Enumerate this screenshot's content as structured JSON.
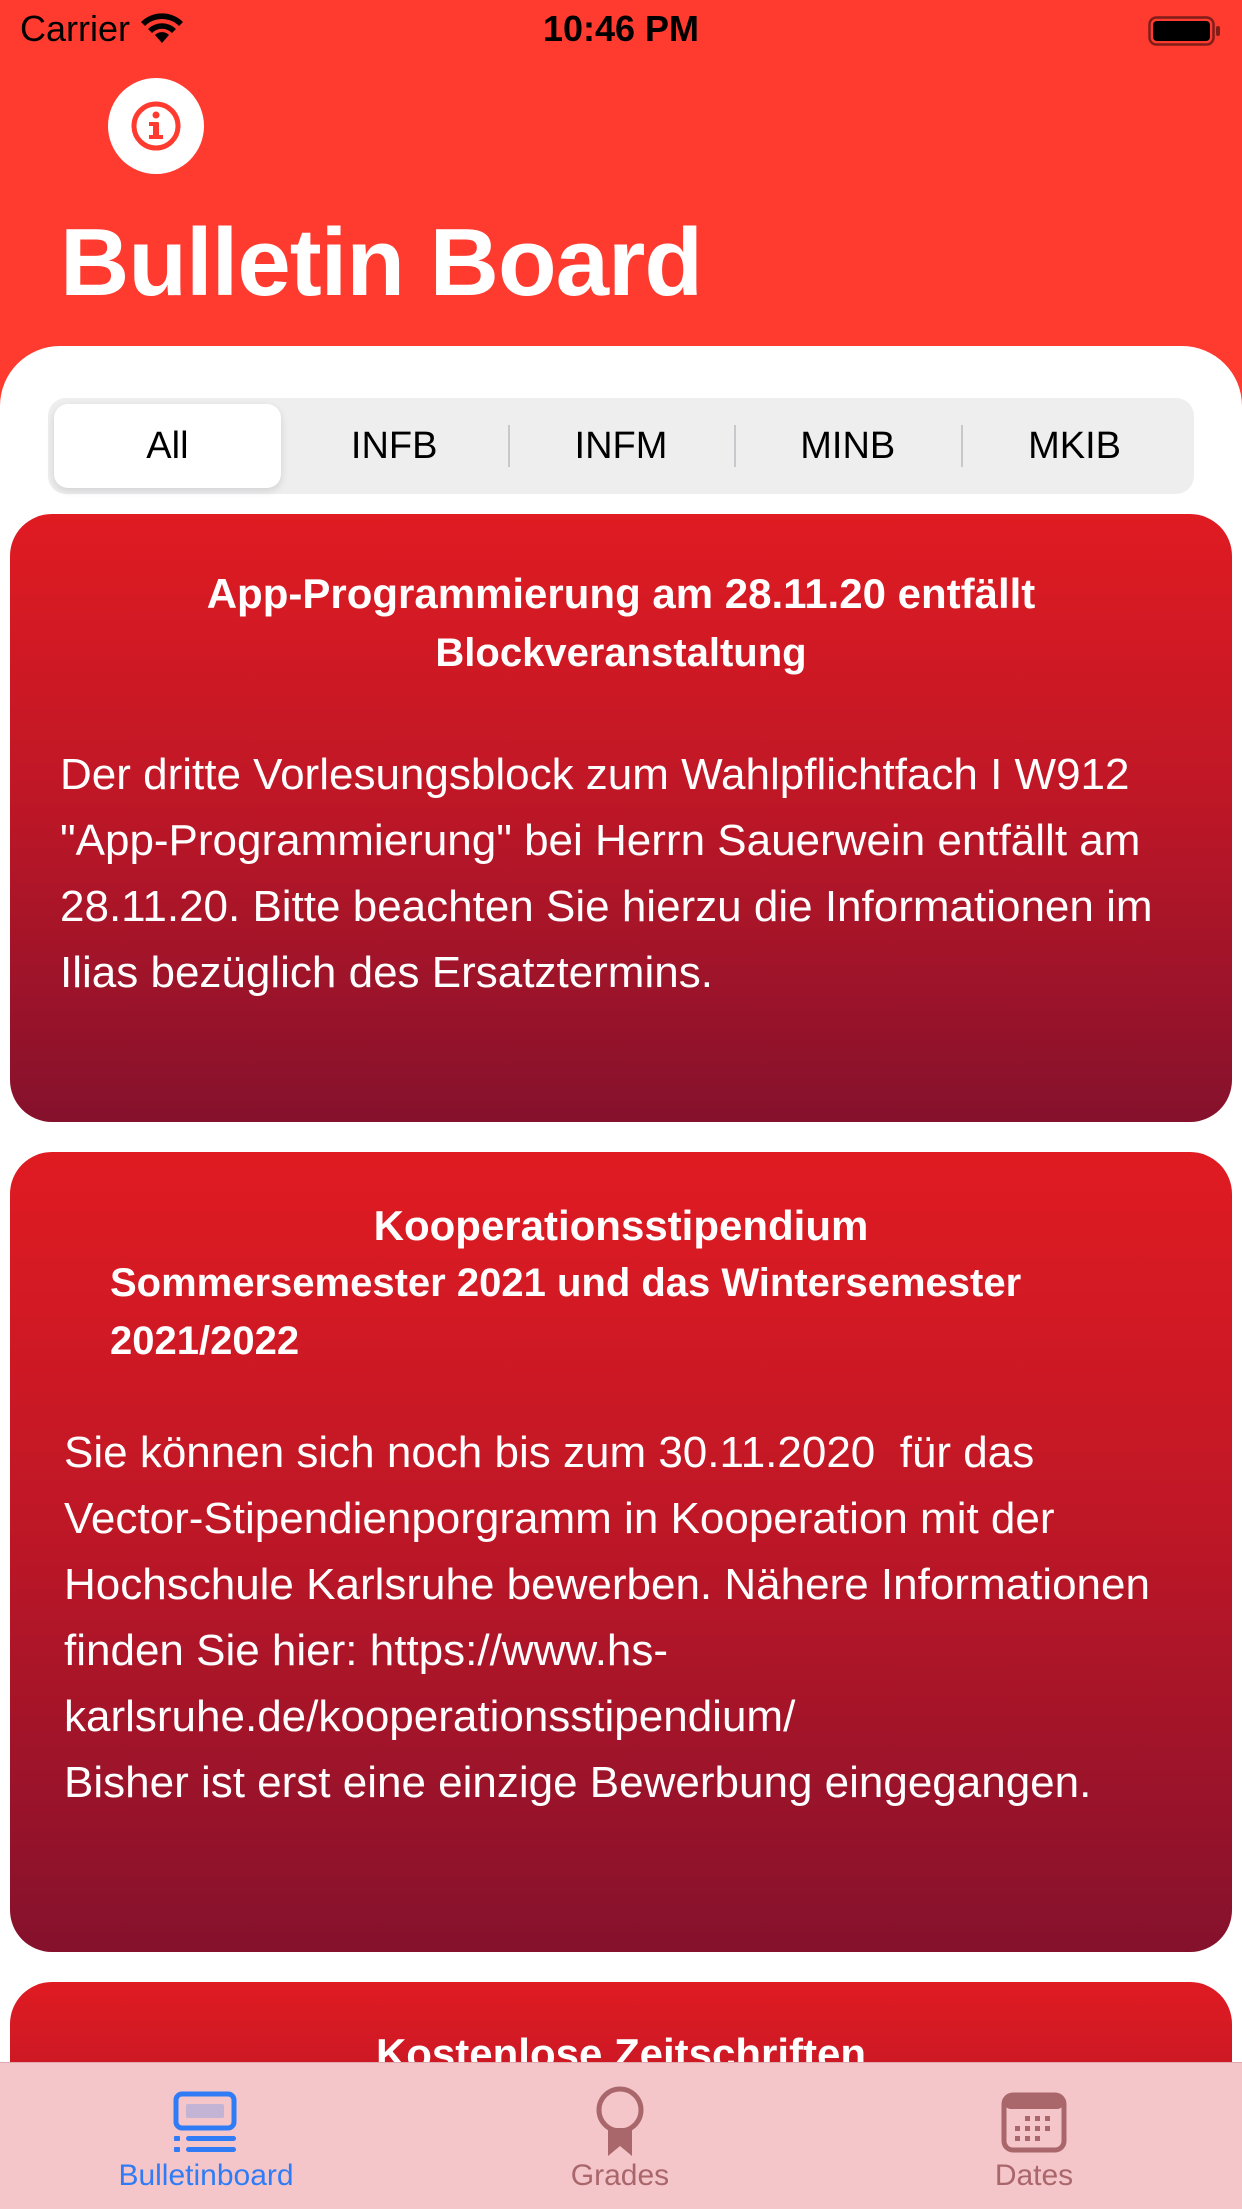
{
  "status_bar": {
    "carrier": "Carrier",
    "time": "10:46 PM"
  },
  "header": {
    "title": "Bulletin Board"
  },
  "segments": [
    {
      "label": "All",
      "selected": true
    },
    {
      "label": "INFB",
      "selected": false
    },
    {
      "label": "INFM",
      "selected": false
    },
    {
      "label": "MINB",
      "selected": false
    },
    {
      "label": "MKIB",
      "selected": false
    }
  ],
  "bulletins": [
    {
      "title": "App-Programmierung am 28.11.20 entfällt",
      "subtitle": "Blockveranstaltung",
      "body": "Der dritte Vorlesungsblock zum Wahlpflichtfach I W912 \"App-Programmierung\" bei Herrn Sauerwein entfällt am 28.11.20. Bitte beachten Sie hierzu die Informationen im Ilias bezüglich des Ersatztermins."
    },
    {
      "title": "Kooperationsstipendium",
      "subtitle": "Sommersemester 2021 und das Wintersemester 2021/2022",
      "body": "Sie können sich noch bis zum 30.11.2020  für das Vector-Stipendienporgramm in Kooperation mit der Hochschule Karlsruhe bewerben. Nähere Informationen finden Sie hier: https://www.hs-karlsruhe.de/kooperationsstipendium/\nBisher ist erst eine einzige Bewerbung eingegangen."
    },
    {
      "title": "Kostenlose Zeitschriften"
    }
  ],
  "tabbar": {
    "items": [
      {
        "label": "Bulletinboard",
        "icon": "bulletinboard-icon",
        "selected": true
      },
      {
        "label": "Grades",
        "icon": "award-icon",
        "selected": false
      },
      {
        "label": "Dates",
        "icon": "calendar-icon",
        "selected": false
      }
    ],
    "active_color": "#2f7cf6",
    "inactive_color": "#a9676c"
  },
  "colors": {
    "header": "#ff3b30",
    "card_top": "#e01b22",
    "card_bottom": "#85112c"
  }
}
